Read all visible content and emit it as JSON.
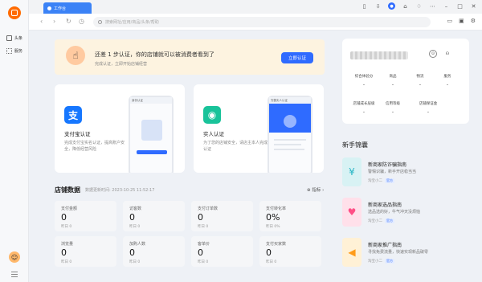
{
  "colors": {
    "accent": "#2f6bff",
    "brand": "#ff6a00",
    "banner_bg": "#fdf3e0"
  },
  "sidebar": {
    "items": [
      {
        "label": "头条",
        "icon": "newspaper-icon"
      },
      {
        "label": "服务",
        "icon": "grid-icon"
      }
    ]
  },
  "tabbar": {
    "tab_label": "工作台"
  },
  "addressbar": {
    "placeholder": "搜索网址/应用/商品/头条/帮助"
  },
  "banner": {
    "title": "还差 1 步认证，你的店铺就可以被消费者看到了",
    "subtitle": "完成认证，立即开始店铺经营",
    "button": "立即认证"
  },
  "cards": [
    {
      "title": "支付宝认证",
      "desc": "完成支付宝实名认证，提高账户安全，降低经营风险",
      "icon": "alipay-icon",
      "color": "#1677ff",
      "phone_title": "身份认证",
      "phone_btn": "上传身份证件"
    },
    {
      "title": "实人认证",
      "desc": "为了您的店铺安全，请店主本人完成认证",
      "icon": "person-verify-icon",
      "color": "#19c39a",
      "phone_title": "完善实人认证"
    }
  ],
  "store": {
    "title": "店铺数据",
    "time": "数据更新时间: 2023-10-25 11:52:17",
    "link": "指标",
    "stats": [
      {
        "label": "支付金额",
        "value": "0",
        "cmp": "昨日 0"
      },
      {
        "label": "访客数",
        "value": "0",
        "cmp": "昨日 0"
      },
      {
        "label": "支付订单数",
        "value": "0",
        "cmp": "昨日 0"
      },
      {
        "label": "支付转化率",
        "value": "0%",
        "cmp": "昨日 0%"
      },
      {
        "label": "浏览量",
        "value": "0",
        "cmp": "昨日 0"
      },
      {
        "label": "加购人数",
        "value": "0",
        "cmp": "昨日 0"
      },
      {
        "label": "客单价",
        "value": "0",
        "cmp": "昨日 0"
      },
      {
        "label": "支付买家数",
        "value": "0",
        "cmp": "昨日 0"
      }
    ]
  },
  "user_card": {
    "row1": [
      "综合体验分",
      "商品",
      "物流",
      "服务"
    ],
    "row2": [
      "店铺成长层级",
      "信用等级",
      "店铺保证金"
    ],
    "dash": "-"
  },
  "guides": {
    "title": "新手锦囊",
    "items": [
      {
        "title": "新商家防诈骗指南",
        "desc": "警惕识骗，新手开店稳当当",
        "src": "淘宝小二",
        "tag": "官方",
        "icon": "shield-icon",
        "color": "#d8f2f4",
        "glyph": "¥"
      },
      {
        "title": "新商家选品指南",
        "desc": "选品选的好，牛气冲天没烦恼",
        "src": "淘宝小二",
        "tag": "官方",
        "icon": "shopping-bag-icon",
        "color": "#ffe0ea",
        "glyph": "♥"
      },
      {
        "title": "新商家推广指南",
        "desc": "寻找免费流量，快速实现新品破零",
        "src": "淘宝小二",
        "tag": "官方",
        "icon": "megaphone-icon",
        "color": "#fff1d6",
        "glyph": "◀"
      }
    ]
  }
}
